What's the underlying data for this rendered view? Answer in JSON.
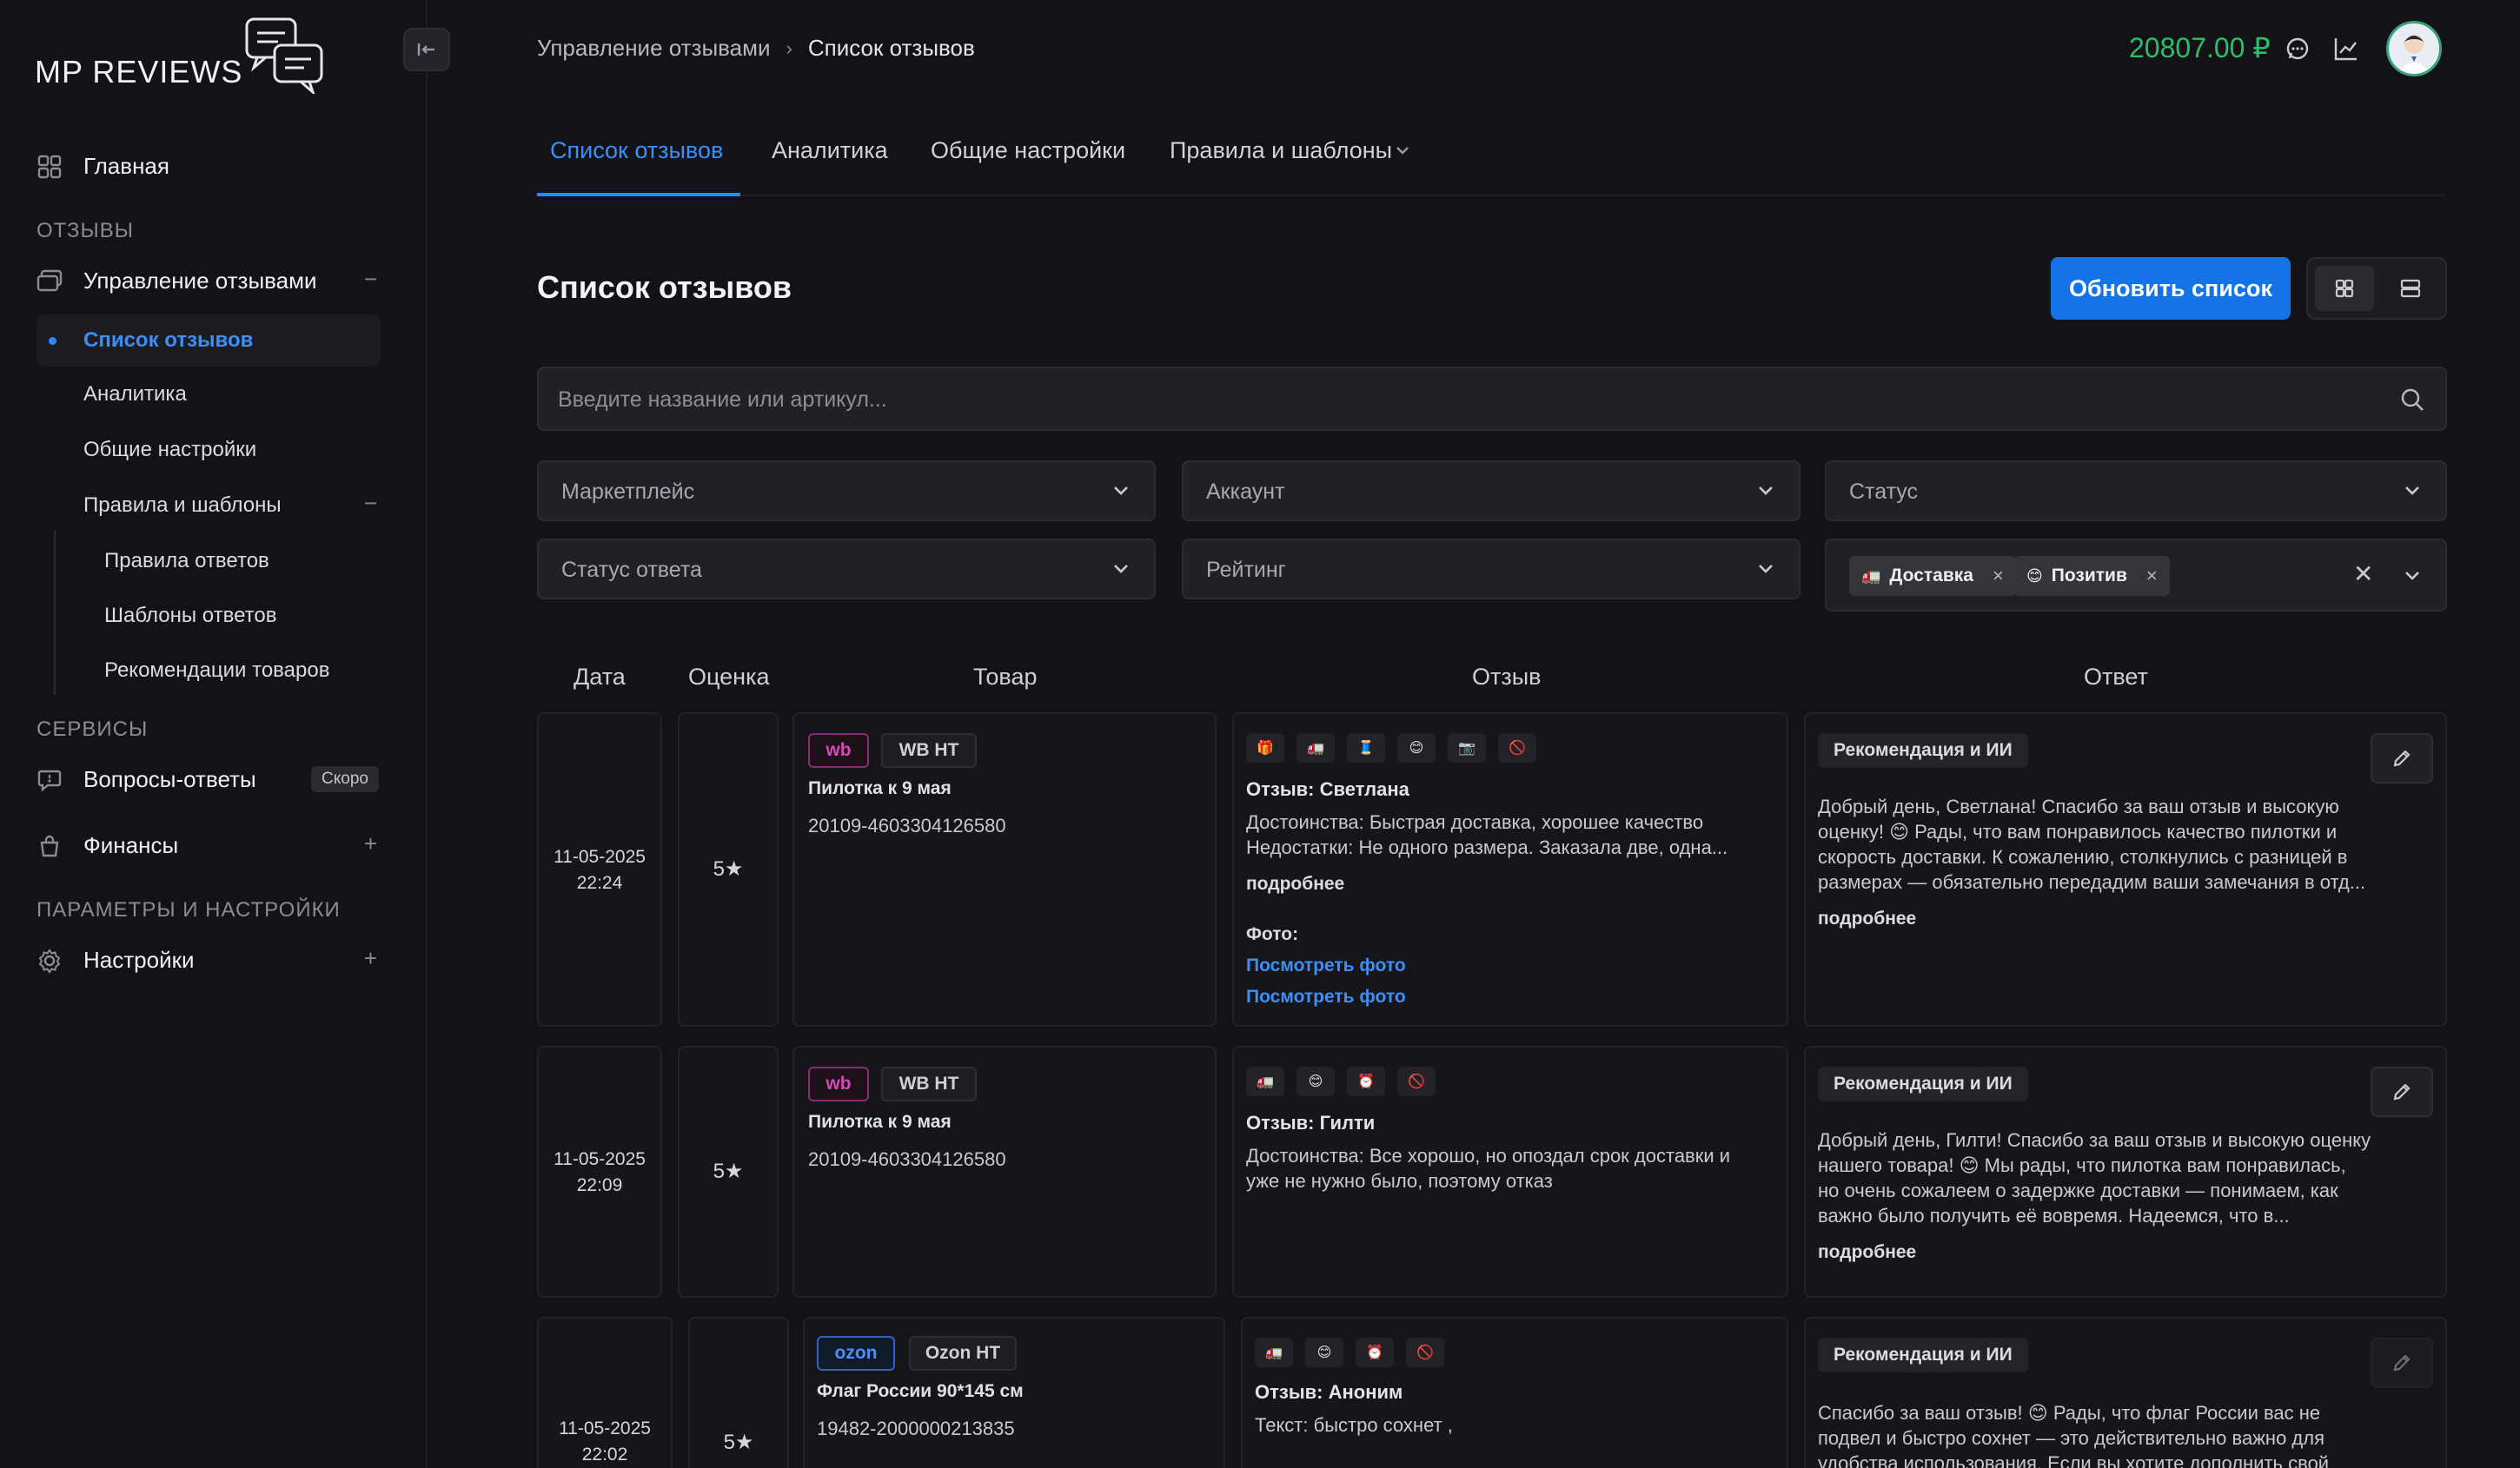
{
  "app": {
    "logo_text": "MP REVIEWS"
  },
  "sidebar": {
    "home": "Главная",
    "section_reviews": "ОТЗЫВЫ",
    "manage_reviews": "Управление отзывами",
    "reviews_list": "Список отзывов",
    "analytics": "Аналитика",
    "general_settings": "Общие настройки",
    "rules_templates": "Правила и шаблоны",
    "answer_rules": "Правила ответов",
    "answer_templates": "Шаблоны ответов",
    "product_recs": "Рекомендации товаров",
    "section_services": "СЕРВИСЫ",
    "questions": "Вопросы-ответы",
    "soon_badge": "Скоро",
    "finance": "Финансы",
    "section_params": "ПАРАМЕТРЫ И НАСТРОЙКИ",
    "settings": "Настройки",
    "minus": "−",
    "plus": "+"
  },
  "header": {
    "breadcrumb_parent": "Управление отзывами",
    "breadcrumb_sep": "›",
    "breadcrumb_current": "Список отзывов",
    "balance": "20807.00 ₽"
  },
  "tabs": [
    "Список отзывов",
    "Аналитика",
    "Общие настройки",
    "Правила и шаблоны"
  ],
  "page": {
    "title": "Список отзывов",
    "refresh_label": "Обновить список",
    "search_placeholder": "Введите название или артикул..."
  },
  "filters": {
    "marketplace": "Маркетплейс",
    "account": "Аккаунт",
    "status": "Статус",
    "answer_status": "Статус ответа",
    "rating": "Рейтинг",
    "tags": [
      {
        "emoji": "🚛",
        "label": "Доставка",
        "remove": "×"
      },
      {
        "emoji": "😊",
        "label": "Позитив",
        "remove": "×"
      }
    ],
    "clear": "✕"
  },
  "table": {
    "headers": {
      "date": "Дата",
      "score": "Оценка",
      "product": "Товар",
      "review": "Отзыв",
      "answer": "Ответ"
    },
    "rows": [
      {
        "date": "11-05-2025",
        "time": "22:24",
        "score": "5★",
        "marketplace": "wb",
        "account": "WB НТ",
        "product": "Пилотка к 9 мая",
        "sku": "20109-4603304126580",
        "emojis": [
          "🎁",
          "🚛",
          "🧵",
          "😊",
          "📷",
          "🚫"
        ],
        "author": "Отзыв: Светлана",
        "text_1": "Достоинства: Быстрая доставка, хорошее качество",
        "text_2": "Недостатки: Не одного размера. Заказала две, одна...",
        "more": "подробнее",
        "photo_label": "Фото:",
        "photo_link": "Посмотреть фото",
        "answer_badge": "Рекомендация и ИИ",
        "answer_1": "Добрый день, Светлана! Спасибо за ваш отзыв и высокую",
        "answer_2": "оценку! 😊 Рады, что вам понравилось качество пилотки и",
        "answer_3": "скорость доставки. К сожалению, столкнулись с разницей в",
        "answer_4": "размерах — обязательно передадим ваши замечания в отд...",
        "answer_more": "подробнее"
      },
      {
        "date": "11-05-2025",
        "time": "22:09",
        "score": "5★",
        "marketplace": "wb",
        "account": "WB НТ",
        "product": "Пилотка к 9 мая",
        "sku": "20109-4603304126580",
        "emojis": [
          "🚛",
          "😊",
          "⏰",
          "🚫"
        ],
        "author": "Отзыв: Гилти",
        "text_1": "Достоинства: Все хорошо, но опоздал срок доставки и",
        "text_2": "уже не нужно было, поэтому отказ",
        "answer_badge": "Рекомендация и ИИ",
        "answer_1": "Добрый день, Гилти! Спасибо за ваш отзыв и высокую оценку",
        "answer_2": "нашего товара! 😊 Мы рады, что пилотка вам понравилась,",
        "answer_3": "но очень сожалеем о задержке доставки — понимаем, как",
        "answer_4": "важно было получить её вовремя. Надеемся, что в...",
        "answer_more": "подробнее"
      },
      {
        "date": "11-05-2025",
        "time": "22:02",
        "score": "5★",
        "marketplace": "ozon",
        "account": "Ozon НТ",
        "product": "Флаг России 90*145 см",
        "sku": "19482-2000000213835",
        "emojis": [
          "🚛",
          "😊",
          "⏰",
          "🚫"
        ],
        "author": "Отзыв: Аноним",
        "text_1": "Текст: быстро сохнет ,",
        "answer_badge": "Рекомендация и ИИ",
        "answer_1": "Спасибо за ваш отзыв! 😊 Рады, что флаг России вас не",
        "answer_2": "подвел и быстро сохнет — это действительно важно для",
        "answer_3": "удобства использования. Если вы хотите дополнить свой"
      }
    ]
  },
  "colors": {
    "accent": "#2f86f6",
    "balance": "#2cbf6a",
    "background": "#131317"
  },
  "icons": [
    "home-icon",
    "reviews-icon",
    "question-icon",
    "bag-icon",
    "gear-icon",
    "collapse-icon",
    "chat-icon",
    "chart-icon",
    "search-icon",
    "chevron-down-icon",
    "grid-view-icon",
    "list-view-icon",
    "edit-icon"
  ]
}
